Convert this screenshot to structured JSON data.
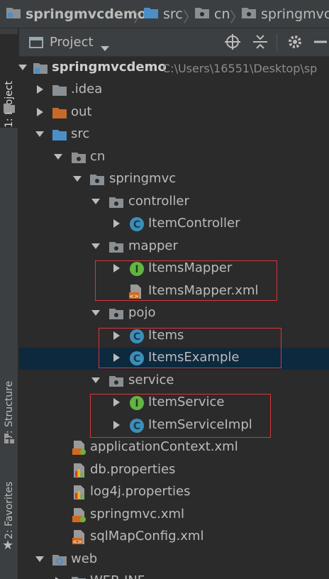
{
  "breadcrumbs": [
    {
      "label": "springmvcdemo",
      "icon": "project-folder-icon"
    },
    {
      "label": "src",
      "icon": "source-folder-icon"
    },
    {
      "label": "cn",
      "icon": "package-folder-icon"
    },
    {
      "label": "springmvc",
      "icon": "package-folder-icon"
    }
  ],
  "tool_windows": {
    "project": "1: Project",
    "structure": "7: Structure",
    "favorites": "2: Favorites"
  },
  "panel": {
    "title": "Project",
    "view_dropdown_icon": "chevron-down-icon",
    "actions": [
      "locate-icon",
      "collapse-all-icon",
      "gear-icon",
      "hide-icon"
    ]
  },
  "tree": {
    "root_label": "springmvcdemo",
    "root_path": "C:\\Users\\16551\\Desktop\\sp",
    "idea": ".idea",
    "out": "out",
    "src": "src",
    "cn": "cn",
    "springmvc": "springmvc",
    "controller": "controller",
    "item_controller": "ItemController",
    "mapper": "mapper",
    "items_mapper": "ItemsMapper",
    "items_mapper_xml": "ItemsMapper.xml",
    "pojo": "pojo",
    "items": "Items",
    "items_example": "ItemsExample",
    "service": "service",
    "item_service": "ItemService",
    "item_service_impl": "ItemServiceImpl",
    "application_context": "applicationContext.xml",
    "db_properties": "db.properties",
    "log4j_properties": "log4j.properties",
    "springmvc_xml": "springmvc.xml",
    "sql_map_config": "sqlMapConfig.xml",
    "web": "web",
    "web_inf": "WEB-INF"
  },
  "colors": {
    "background": "#2b2b2b",
    "panel": "#3c3f41",
    "selection": "#0d293e",
    "highlight_box": "#d9363a",
    "class_icon": "#3d8eb9",
    "interface_icon": "#62b543",
    "xml_icon": "#d2691e",
    "folder": "#8a8f93",
    "source_folder": "#4b8fc9",
    "excluded_folder": "#c6692b"
  }
}
